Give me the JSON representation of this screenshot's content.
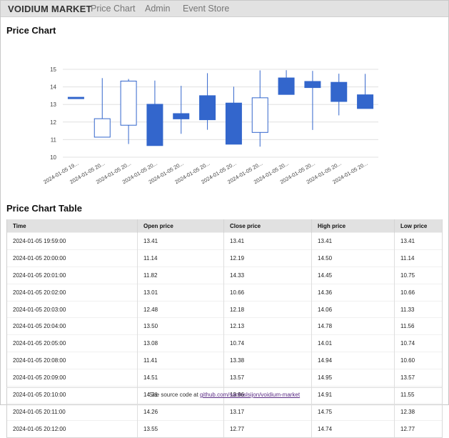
{
  "nav": {
    "brand": "VOIDIUM MARKET",
    "links": [
      "Price Chart",
      "Admin",
      "Event Store"
    ]
  },
  "chart_section": {
    "title": "Price Chart"
  },
  "table_section": {
    "title": "Price Chart Table"
  },
  "table": {
    "headers": [
      "Time",
      "Open price",
      "Close price",
      "High price",
      "Low price"
    ],
    "rows": [
      [
        "2024-01-05 19:59:00",
        "13.41",
        "13.41",
        "13.41",
        "13.41"
      ],
      [
        "2024-01-05 20:00:00",
        "11.14",
        "12.19",
        "14.50",
        "11.14"
      ],
      [
        "2024-01-05 20:01:00",
        "11.82",
        "14.33",
        "14.45",
        "10.75"
      ],
      [
        "2024-01-05 20:02:00",
        "13.01",
        "10.66",
        "14.36",
        "10.66"
      ],
      [
        "2024-01-05 20:03:00",
        "12.48",
        "12.18",
        "14.06",
        "11.33"
      ],
      [
        "2024-01-05 20:04:00",
        "13.50",
        "12.13",
        "14.78",
        "11.56"
      ],
      [
        "2024-01-05 20:05:00",
        "13.08",
        "10.74",
        "14.01",
        "10.74"
      ],
      [
        "2024-01-05 20:08:00",
        "11.41",
        "13.38",
        "14.94",
        "10.60"
      ],
      [
        "2024-01-05 20:09:00",
        "14.51",
        "13.57",
        "14.95",
        "13.57"
      ],
      [
        "2024-01-05 20:10:00",
        "14.31",
        "13.96",
        "14.91",
        "11.55"
      ],
      [
        "2024-01-05 20:11:00",
        "14.26",
        "13.17",
        "14.75",
        "12.38"
      ],
      [
        "2024-01-05 20:12:00",
        "13.55",
        "12.77",
        "14.74",
        "12.77"
      ]
    ]
  },
  "footer": {
    "prefix": "See source code at ",
    "link_text": "github.com/santoslsijon/voidium-market"
  },
  "colors": {
    "falling_fill": "#3366cc",
    "rising_fill": "#ffffff",
    "candle_stroke": "#3366cc",
    "gridline": "#e0e0e0",
    "axis_text": "#444444"
  },
  "chart_data": {
    "type": "candlestick",
    "title": "",
    "xlabel": "",
    "ylabel": "",
    "ylim": [
      10,
      15
    ],
    "yticks": [
      10,
      11,
      12,
      13,
      14,
      15
    ],
    "grid": true,
    "categories": [
      "2024-01-05 19...",
      "2024-01-05 20...",
      "2024-01-05 20...",
      "2024-01-05 20...",
      "2024-01-05 20...",
      "2024-01-05 20...",
      "2024-01-05 20...",
      "2024-01-05 20...",
      "2024-01-05 20...",
      "2024-01-05 20...",
      "2024-01-05 20...",
      "2024-01-05 20..."
    ],
    "open": [
      13.41,
      11.14,
      11.82,
      13.01,
      12.48,
      13.5,
      13.08,
      11.41,
      14.51,
      14.31,
      14.26,
      13.55
    ],
    "close": [
      13.41,
      12.19,
      14.33,
      10.66,
      12.18,
      12.13,
      10.74,
      13.38,
      13.57,
      13.96,
      13.17,
      12.77
    ],
    "high": [
      13.41,
      14.5,
      14.45,
      14.36,
      14.06,
      14.78,
      14.01,
      14.94,
      14.95,
      14.91,
      14.75,
      14.74
    ],
    "low": [
      13.41,
      11.14,
      10.75,
      10.66,
      11.33,
      11.56,
      10.74,
      10.6,
      13.57,
      11.55,
      12.38,
      12.77
    ]
  }
}
